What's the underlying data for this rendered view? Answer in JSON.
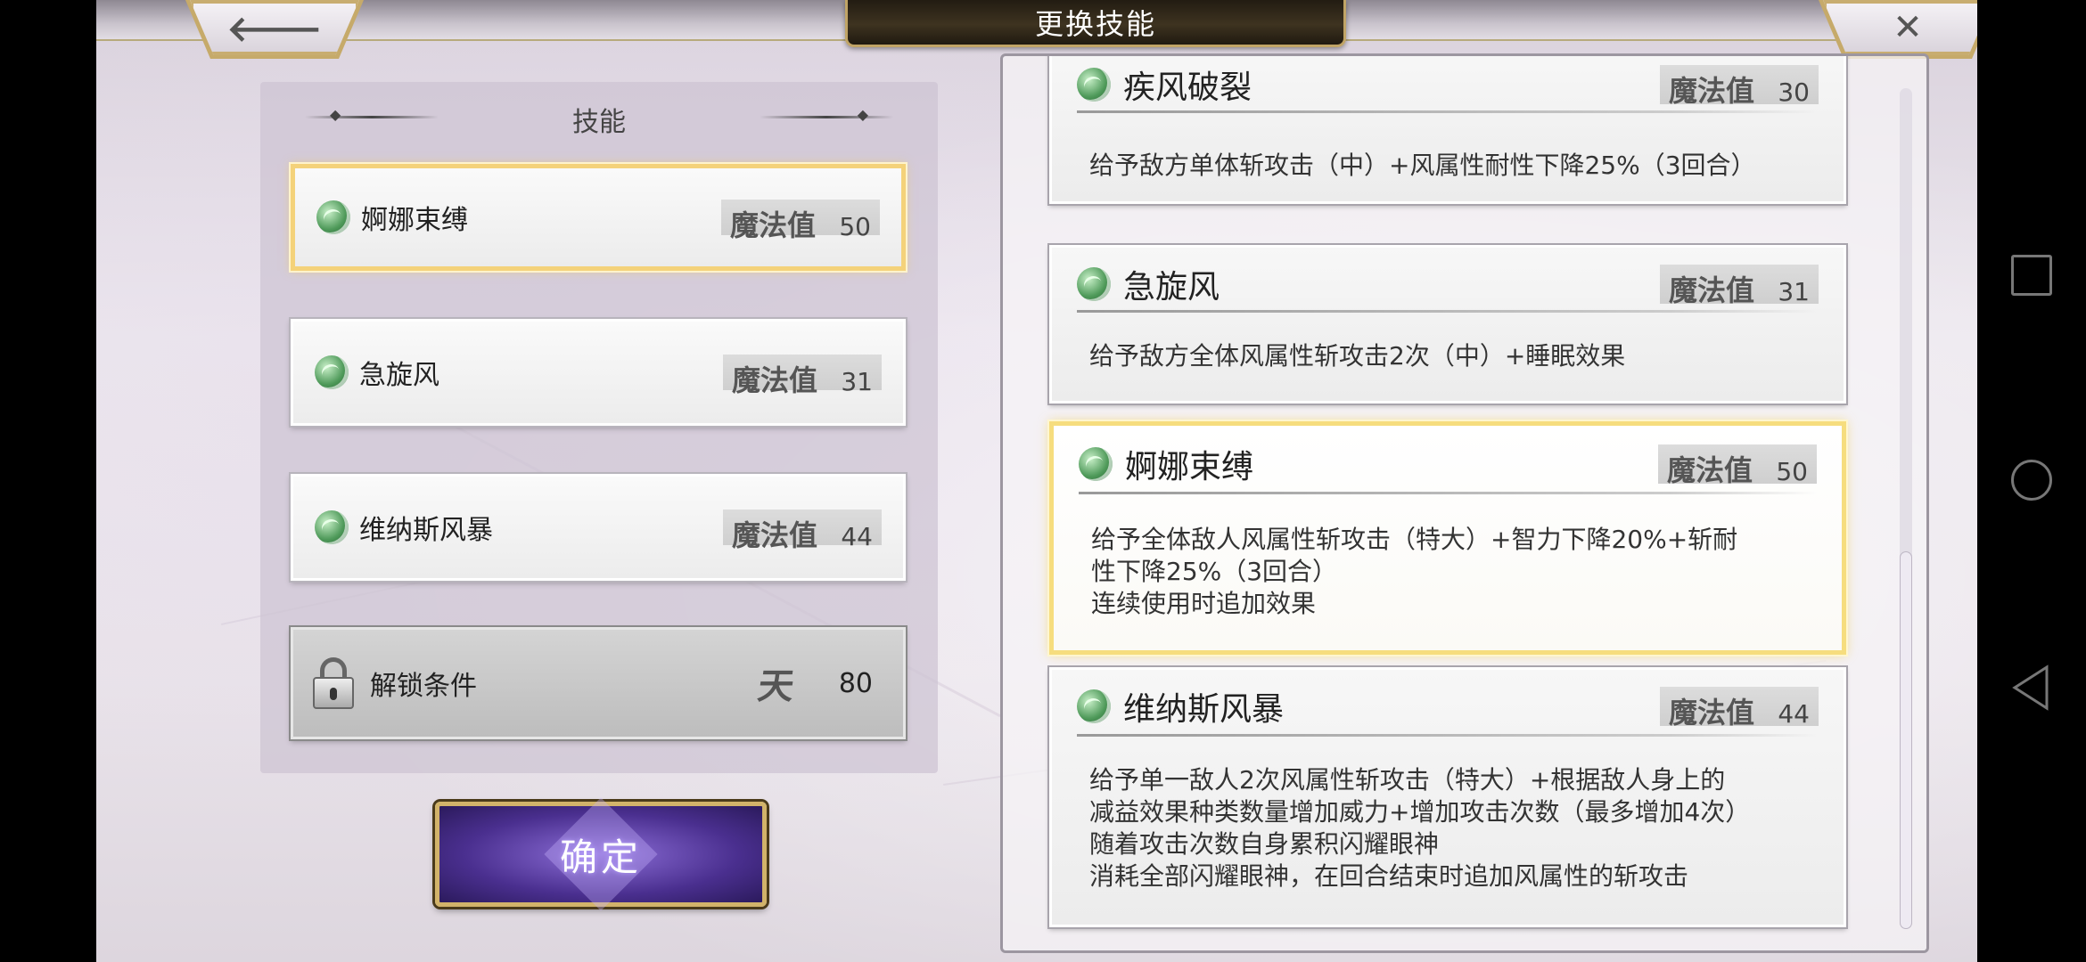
{
  "header": {
    "title": "更换技能",
    "back_glyph": "🡐",
    "close_glyph": "✕"
  },
  "left_panel": {
    "title": "技能",
    "slots": [
      {
        "name": "婀娜束缚",
        "mp_label": "魔法值",
        "mp": "50",
        "icon": "wind-icon",
        "selected": true
      },
      {
        "name": "急旋风",
        "mp_label": "魔法值",
        "mp": "31",
        "icon": "wind-icon",
        "selected": false
      },
      {
        "name": "维纳斯风暴",
        "mp_label": "魔法值",
        "mp": "44",
        "icon": "wind-icon",
        "selected": false
      }
    ],
    "locked_slot": {
      "label": "解锁条件",
      "glyph": "天",
      "value": "80",
      "icon": "lock-icon"
    }
  },
  "confirm_button": {
    "label": "确定"
  },
  "skill_list": [
    {
      "name": "疾风破裂",
      "mp_label": "魔法值",
      "mp": "30",
      "desc": [
        "给予敌方单体斩攻击（中）+风属性耐性下降25%（3回合）"
      ]
    },
    {
      "name": "急旋风",
      "mp_label": "魔法值",
      "mp": "31",
      "desc": [
        "给予敌方全体风属性斩攻击2次（中）+睡眠效果"
      ]
    },
    {
      "name": "婀娜束缚",
      "mp_label": "魔法值",
      "mp": "50",
      "selected": true,
      "desc": [
        "给予全体敌人风属性斩攻击（特大）+智力下降20%+斩耐",
        "性下降25%（3回合）",
        "连续使用时追加效果"
      ]
    },
    {
      "name": "维纳斯风暴",
      "mp_label": "魔法值",
      "mp": "44",
      "desc": [
        "给予单一敌人2次风属性斩攻击（特大）+根据敌人身上的",
        "减益效果种类数量增加威力+增加攻击次数（最多增加4次）",
        "随着攻击次数自身累积闪耀眼神",
        "消耗全部闪耀眼神，在回合结束时追加风属性的斩攻击"
      ]
    }
  ],
  "colors": {
    "selected_border": "#f4d27a",
    "confirm_purple": "#4a2f8f",
    "gold_trim": "#c8ad70"
  },
  "system_nav": [
    "recent-apps",
    "home",
    "back"
  ]
}
